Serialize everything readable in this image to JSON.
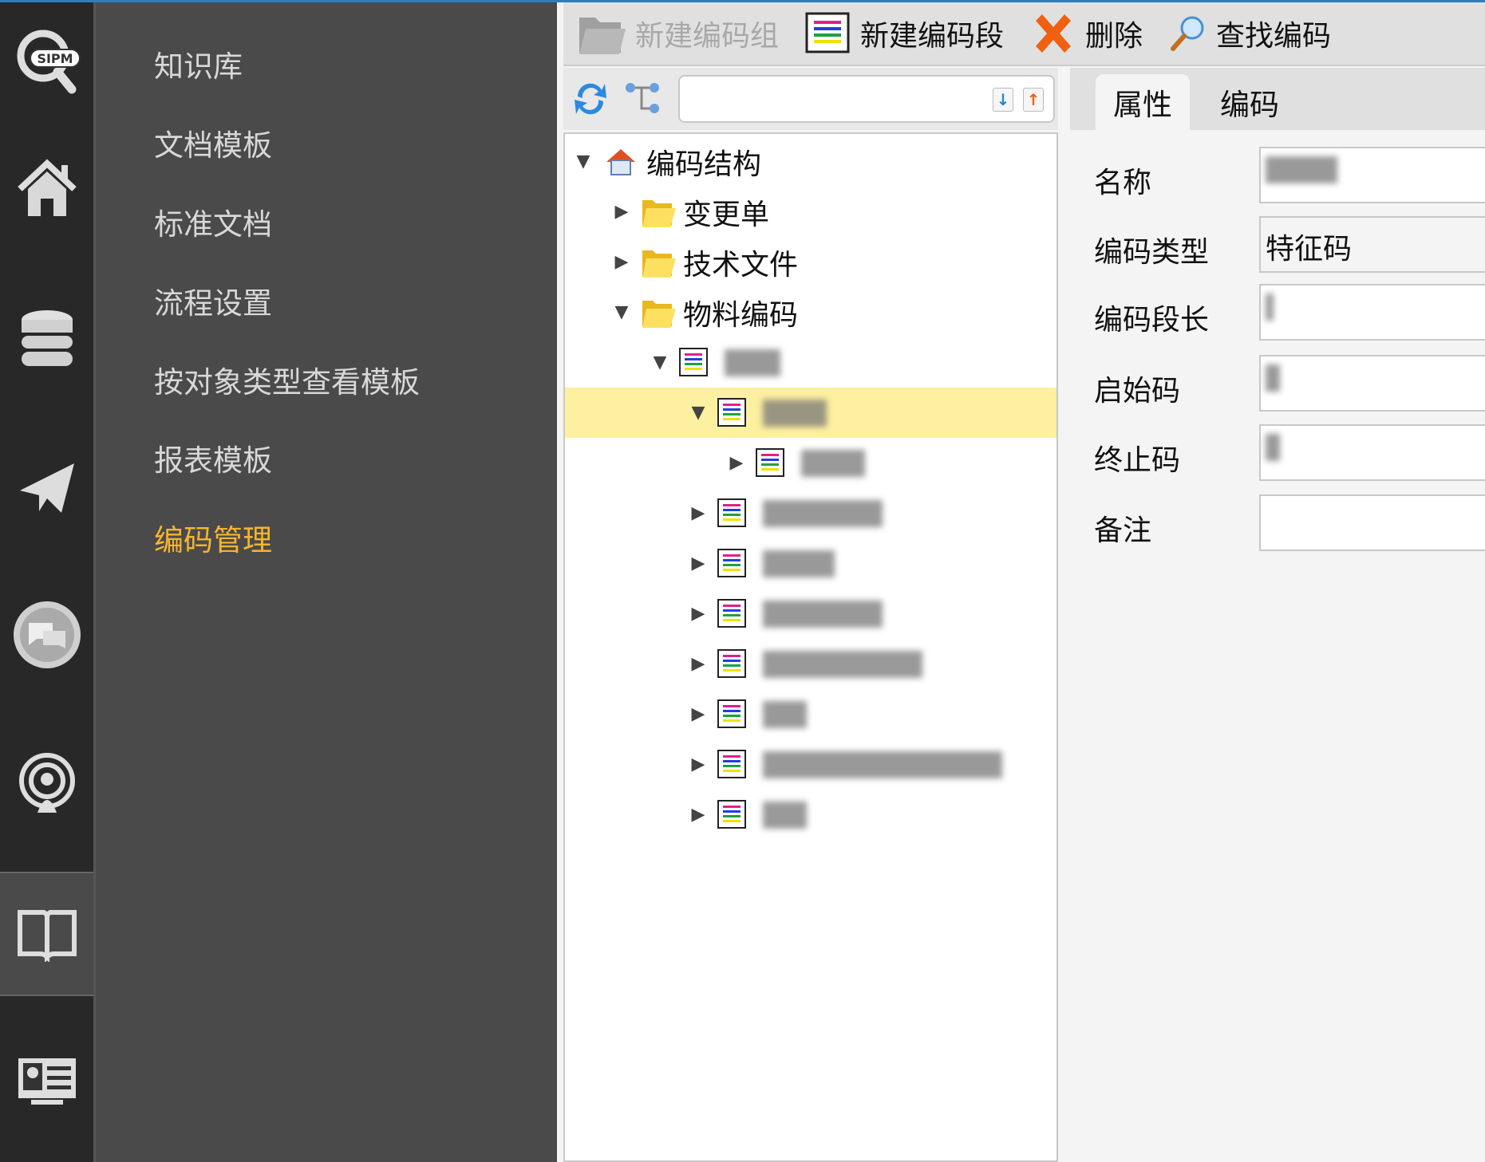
{
  "sidebar_icons": [
    "sipm-logo-icon",
    "home-icon",
    "database-icon",
    "send-icon",
    "chat-icon",
    "podcast-icon",
    "book-icon",
    "id-card-icon"
  ],
  "menu": {
    "items": [
      "知识库",
      "文档模板",
      "标准文档",
      "流程设置",
      "按对象类型查看模板",
      "报表模板",
      "编码管理"
    ],
    "active_index": 6
  },
  "toolbar": {
    "new_group": "新建编码组",
    "new_segment": "新建编码段",
    "delete": "删除",
    "find": "查找编码"
  },
  "search": {
    "value": "",
    "placeholder": ""
  },
  "tree": {
    "root": "编码结构",
    "folders": [
      "变更单",
      "技术文件",
      "物料编码"
    ]
  },
  "tabs": [
    "属性",
    "编码"
  ],
  "form": {
    "labels": [
      "名称",
      "编码类型",
      "编码段长",
      "启始码",
      "终止码",
      "备注"
    ],
    "code_type_value": "特征码"
  },
  "colors": {
    "accent": "#f5b52e",
    "selection": "#fdf0a0"
  }
}
